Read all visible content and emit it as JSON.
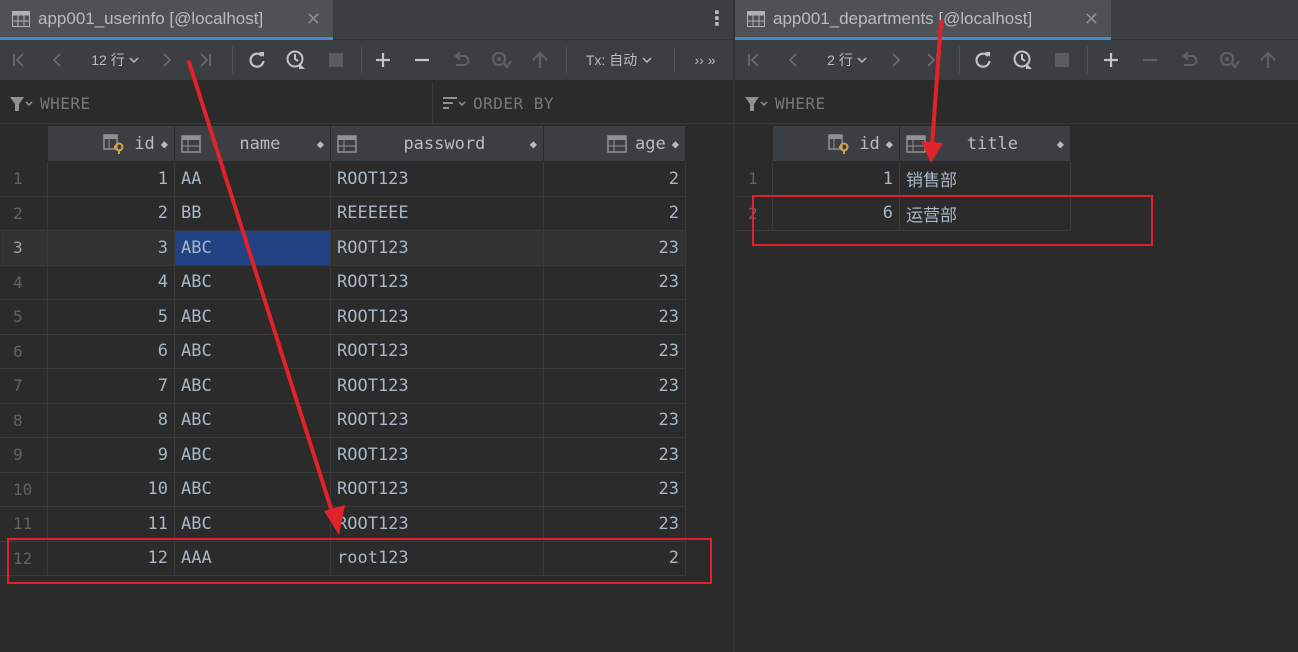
{
  "left": {
    "tab_title": "app001_userinfo [@localhost]",
    "tab_close": "✕",
    "tab_menu": "⋮",
    "toolbar": {
      "rows_label": "12 行",
      "tx_label": "Tx: 自动",
      "more_label": "›› »"
    },
    "filter_where": "WHERE",
    "filter_order": "ORDER BY",
    "columns": [
      "id",
      "name",
      "password",
      "age"
    ],
    "rows": [
      {
        "n": "1",
        "id": "1",
        "name": "AA",
        "password": "ROOT123",
        "age": "2"
      },
      {
        "n": "2",
        "id": "2",
        "name": "BB",
        "password": "REEEEEE",
        "age": "2"
      },
      {
        "n": "3",
        "id": "3",
        "name": "ABC",
        "password": "ROOT123",
        "age": "23"
      },
      {
        "n": "4",
        "id": "4",
        "name": "ABC",
        "password": "ROOT123",
        "age": "23"
      },
      {
        "n": "5",
        "id": "5",
        "name": "ABC",
        "password": "ROOT123",
        "age": "23"
      },
      {
        "n": "6",
        "id": "6",
        "name": "ABC",
        "password": "ROOT123",
        "age": "23"
      },
      {
        "n": "7",
        "id": "7",
        "name": "ABC",
        "password": "ROOT123",
        "age": "23"
      },
      {
        "n": "8",
        "id": "8",
        "name": "ABC",
        "password": "ROOT123",
        "age": "23"
      },
      {
        "n": "9",
        "id": "9",
        "name": "ABC",
        "password": "ROOT123",
        "age": "23"
      },
      {
        "n": "10",
        "id": "10",
        "name": "ABC",
        "password": "ROOT123",
        "age": "23"
      },
      {
        "n": "11",
        "id": "11",
        "name": "ABC",
        "password": "ROOT123",
        "age": "23"
      },
      {
        "n": "12",
        "id": "12",
        "name": "AAA",
        "password": "root123",
        "age": "2"
      }
    ]
  },
  "right": {
    "tab_title": "app001_departments [@localhost]",
    "tab_close": "✕",
    "toolbar": {
      "rows_label": "2 行"
    },
    "filter_where": "WHERE",
    "columns": [
      "id",
      "title"
    ],
    "rows": [
      {
        "n": "1",
        "id": "1",
        "title": "销售部"
      },
      {
        "n": "2",
        "id": "6",
        "title": "运营部"
      }
    ]
  },
  "colors": {
    "background": "#2b2b2b",
    "toolbar": "#3c3f41",
    "active_tab_underline": "#4a88c7",
    "selection": "#214283",
    "annotation_red": "#e0222a"
  },
  "icons": {
    "tab": "table-icon",
    "key_column": "key-column-icon",
    "column": "column-icon",
    "filter": "filter-icon",
    "sort": "sort-icon"
  }
}
